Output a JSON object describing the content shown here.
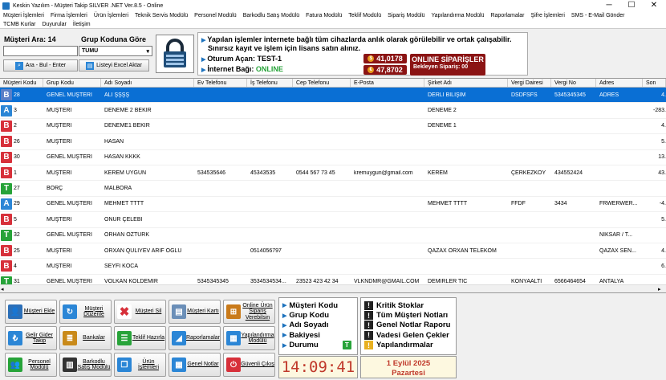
{
  "window": {
    "title": "Keskin Yazılım - Müşteri Takip SILVER .NET Ver.8.5 - Online",
    "minimize": "─",
    "maximize": "☐",
    "close": "✕"
  },
  "menu": {
    "row1": [
      "Müşteri İşlemleri",
      "Firma İşlemleri",
      "Ürün İşlemleri",
      "Teknik Servis Modülü",
      "Personel Modülü",
      "Barkodlu Satış Modülü",
      "Fatura Modülü",
      "Teklif Modülü",
      "Sipariş Modülü",
      "Yapılandırma Modülü",
      "Raporlamalar",
      "Şifre İşlemleri",
      "SMS - E-Mail Gönder"
    ],
    "row2": [
      "TCMB Kurlar",
      "Duyurular",
      "İletişim"
    ]
  },
  "search": {
    "count_label": "Müşteri Ara: 14",
    "group_label": "Grup Koduna Göre",
    "search_value": "",
    "group_select": "TUMU",
    "search_button": "Ara - Bul - Enter",
    "excel_button": "Listeyi Excel Aktar"
  },
  "info": {
    "line1": "Yapılan işlemler internete bağlı tüm cihazlarda anlık olarak görülebilir ve ortak çalışabilir.",
    "line2": "Sınırsız kayıt ve işlem için lisans satın alınız.",
    "session_label": "Oturum Açan: TEST-1",
    "internet_label": "İnternet Bağı: ",
    "internet_status": "ONLINE",
    "rate1": "41,0178",
    "rate2": "47,8702",
    "orders_title": "ONLINE SİPARİŞLER",
    "orders_pending": "Bekleyen Sipariş: 00"
  },
  "table": {
    "columns": [
      "Müşteri Kodu",
      "Grup Kodu",
      "Adı Soyadı",
      "Ev Telefonu",
      "İş Telefonu",
      "Cep Telefonu",
      "E-Posta",
      "Şirket Adı",
      "Vergi Dairesi",
      "Vergi No",
      "Adres",
      "Son"
    ],
    "rows": [
      {
        "badge": "B",
        "color": "#5a7fc7",
        "code": "28",
        "group": "GENEL MÜŞTERİ",
        "name": "ALİ ŞŞŞŞ",
        "ev": "",
        "is": "",
        "cep": "",
        "mail": "",
        "company": "DERLİ BİLİŞİM",
        "vd": "DSDFSFS",
        "vno": "5345345345",
        "addr": "ADRES",
        "son": "4.",
        "selected": true
      },
      {
        "badge": "A",
        "color": "#2b86d6",
        "code": "3",
        "group": "MÜŞTERİ",
        "name": "DENEME 2 BEKİR",
        "ev": "",
        "is": "",
        "cep": "",
        "mail": "",
        "company": "DENEME 2",
        "vd": "",
        "vno": "",
        "addr": "",
        "son": "-283."
      },
      {
        "badge": "B",
        "color": "#d7303a",
        "code": "2",
        "group": "MÜŞTERİ",
        "name": "DENEME1 BEKİR",
        "ev": "",
        "is": "",
        "cep": "",
        "mail": "",
        "company": "DENEME 1",
        "vd": "",
        "vno": "",
        "addr": "",
        "son": "4."
      },
      {
        "badge": "B",
        "color": "#d7303a",
        "code": "26",
        "group": "MÜŞTERİ",
        "name": "HASAN",
        "ev": "",
        "is": "",
        "cep": "",
        "mail": "",
        "company": "",
        "vd": "",
        "vno": "",
        "addr": "",
        "son": "5."
      },
      {
        "badge": "B",
        "color": "#d7303a",
        "code": "30",
        "group": "GENEL MÜŞTERİ",
        "name": "HASAN KKKK",
        "ev": "",
        "is": "",
        "cep": "",
        "mail": "",
        "company": "",
        "vd": "",
        "vno": "",
        "addr": "",
        "son": "13."
      },
      {
        "badge": "B",
        "color": "#d7303a",
        "code": "1",
        "group": "MÜŞTERİ",
        "name": "KEREM UYGUN",
        "ev": "534535646",
        "is": "45343535",
        "cep": "0544 567 73 45",
        "mail": "kremuygun@gmail.com",
        "company": "KEREM",
        "vd": "ÇERKEZKÖY",
        "vno": "434552424",
        "addr": "",
        "son": "43."
      },
      {
        "badge": "T",
        "color": "#27a339",
        "code": "27",
        "group": "BORÇ",
        "name": "MALBORA",
        "ev": "",
        "is": "",
        "cep": "",
        "mail": "",
        "company": "",
        "vd": "",
        "vno": "",
        "addr": "",
        "son": ""
      },
      {
        "badge": "A",
        "color": "#2b86d6",
        "code": "29",
        "group": "GENEL MÜŞTERİ",
        "name": "MEHMET TTTT",
        "ev": "",
        "is": "",
        "cep": "",
        "mail": "",
        "company": "MEHMET TTTT",
        "vd": "FFDF",
        "vno": "3434",
        "addr": "FRWERWER...",
        "son": "-4."
      },
      {
        "badge": "B",
        "color": "#d7303a",
        "code": "5",
        "group": "MÜŞTERİ",
        "name": "ONUR ÇELEBİ",
        "ev": "",
        "is": "",
        "cep": "",
        "mail": "",
        "company": "",
        "vd": "",
        "vno": "",
        "addr": "",
        "son": "5."
      },
      {
        "badge": "T",
        "color": "#27a339",
        "code": "32",
        "group": "GENEL MÜŞTERİ",
        "name": "ORHAN ÖZTÜRK",
        "ev": "",
        "is": "",
        "cep": "",
        "mail": "",
        "company": "",
        "vd": "",
        "vno": "",
        "addr": "NİKSAR / T...",
        "son": ""
      },
      {
        "badge": "B",
        "color": "#d7303a",
        "code": "25",
        "group": "MÜŞTERİ",
        "name": "ORXAN QULİYEV ARİF OGLU",
        "ev": "",
        "is": "0514056797",
        "cep": "",
        "mail": "",
        "company": "QAZAX ORXAN TELEKOM",
        "vd": "",
        "vno": "",
        "addr": "QAZAX SEN...",
        "son": "4."
      },
      {
        "badge": "B",
        "color": "#d7303a",
        "code": "4",
        "group": "MÜŞTERİ",
        "name": "SEYFİ KOCA",
        "ev": "",
        "is": "",
        "cep": "",
        "mail": "",
        "company": "",
        "vd": "",
        "vno": "",
        "addr": "",
        "son": "6."
      },
      {
        "badge": "T",
        "color": "#27a339",
        "code": "31",
        "group": "GENEL MÜŞTERİ",
        "name": "VOLKAN KOLDEMİR",
        "ev": "5345345345",
        "is": "3534534534...",
        "cep": "23523 423 42 34",
        "mail": "VLKNDMR@GMAIL.COM",
        "company": "DEMİRLER TİC",
        "vd": "KONYAALTI",
        "vno": "6566464654",
        "addr": "ANTALYA",
        "son": ""
      }
    ]
  },
  "buttons": [
    {
      "label": "Müşteri Ekle",
      "icon": "user-add-icon",
      "color": "#2b6fb8",
      "glyph": "👤"
    },
    {
      "label": "Müşteri Düzenle",
      "icon": "edit-icon",
      "color": "#2b86d6",
      "glyph": "↻"
    },
    {
      "label": "Müşteri Sil",
      "icon": "delete-icon",
      "color": "#ffffff",
      "glyph": "✖"
    },
    {
      "label": "Müşteri Kartı",
      "icon": "card-icon",
      "color": "#6b8fb8",
      "glyph": "▤"
    },
    {
      "label": "Online Ürün Sipariş Verebilsin",
      "icon": "cart-icon",
      "color": "#c97a1a",
      "glyph": "⊞"
    },
    {
      "label": "Gelir Gider Takip",
      "icon": "cash-icon",
      "color": "#2b86d6",
      "glyph": "₺"
    },
    {
      "label": "Bankalar",
      "icon": "bank-icon",
      "color": "#c98a1a",
      "glyph": "≣"
    },
    {
      "label": "Teklif Hazırla",
      "icon": "offer-icon",
      "color": "#27a339",
      "glyph": "☰"
    },
    {
      "label": "Raporlamalar",
      "icon": "report-icon",
      "color": "#2b86d6",
      "glyph": "◢"
    },
    {
      "label": "Yapılandırma Modülü",
      "icon": "config-icon",
      "color": "#2b86d6",
      "glyph": "▦"
    },
    {
      "label": "Personel Modülü",
      "icon": "staff-icon",
      "color": "#27a339",
      "glyph": "👥"
    },
    {
      "label": "Barkodlu Satış Modülü",
      "icon": "barcode-icon",
      "color": "#333333",
      "glyph": "▥"
    },
    {
      "label": "Ürün İşlemleri",
      "icon": "box-icon",
      "color": "#2b86d6",
      "glyph": "❒"
    },
    {
      "label": "Genel Notlar",
      "icon": "calendar-icon",
      "color": "#2b86d6",
      "glyph": "▦"
    },
    {
      "label": "Güvenli Çıkış",
      "icon": "power-icon",
      "color": "#d7303a",
      "glyph": "⏻"
    }
  ],
  "sort_panel": {
    "items": [
      "Müşteri Kodu",
      "Grup Kodu",
      "Adı Soyadı",
      "Bakiyesi",
      "Durumu"
    ],
    "durum_badge": "T"
  },
  "clock": "14:09:41",
  "date_line1": "1 Eylül 2025",
  "date_line2": "Pazartesi",
  "reports": [
    "Kritik Stoklar",
    "Tüm Müşteri Notları",
    "Genel Notlar Raporu",
    "Vadesi Gelen Çekler",
    "Yapılandırmalar"
  ]
}
